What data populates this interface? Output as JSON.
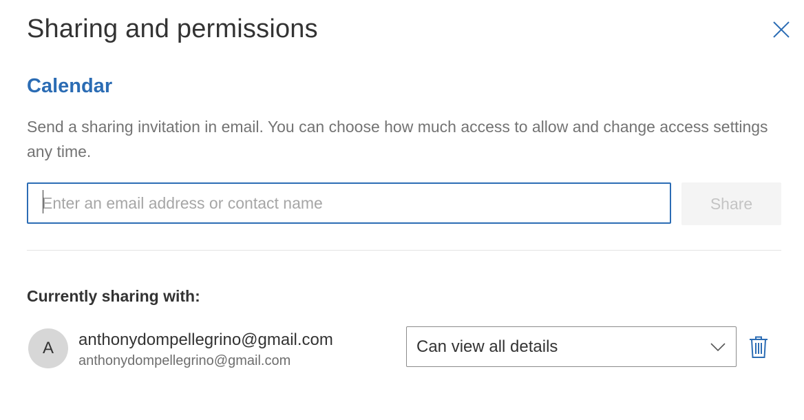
{
  "dialog": {
    "title": "Sharing and permissions",
    "close_icon": "close-icon"
  },
  "calendar": {
    "heading": "Calendar",
    "description": "Send a sharing invitation in email. You can choose how much access to allow and change access settings any time."
  },
  "invite": {
    "email_value": "",
    "email_placeholder": "Enter an email address or contact name",
    "share_label": "Share"
  },
  "sharing": {
    "heading": "Currently sharing with:",
    "people": [
      {
        "avatar_initial": "A",
        "name": "anthonydompellegrino@gmail.com",
        "email": "anthonydompellegrino@gmail.com",
        "permission": "Can view all details",
        "dropdown_icon": "chevron-down-icon",
        "delete_icon": "trash-icon"
      }
    ]
  },
  "colors": {
    "accent": "#2b6cb4",
    "title_text": "#333333",
    "muted_text": "#737373",
    "disabled_button_bg": "#f4f4f4",
    "disabled_button_text": "#c4c4c4",
    "avatar_bg": "#d7d7d7"
  }
}
